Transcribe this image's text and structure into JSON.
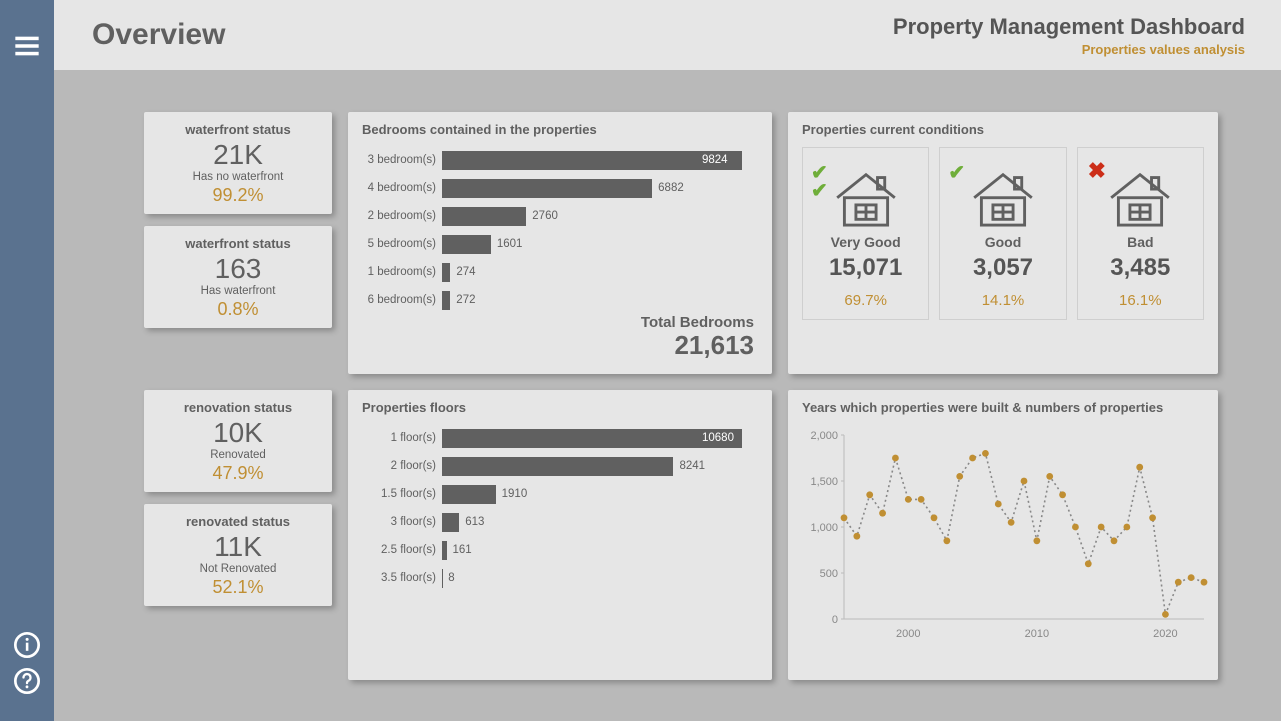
{
  "header": {
    "page_title": "Overview",
    "dash_title": "Property Management Dashboard",
    "dash_sub": "Properties values analysis"
  },
  "stats": [
    {
      "title": "waterfront status",
      "big": "21K",
      "mid": "Has no waterfront",
      "pct": "99.2%"
    },
    {
      "title": "waterfront status",
      "big": "163",
      "mid": "Has waterfront",
      "pct": "0.8%"
    },
    {
      "title": "renovation status",
      "big": "10K",
      "mid": "Renovated",
      "pct": "47.9%"
    },
    {
      "title": "renovated status",
      "big": "11K",
      "mid": "Not Renovated",
      "pct": "52.1%"
    }
  ],
  "bedrooms_card_title": "Bedrooms contained in the properties",
  "bedrooms_total_label": "Total Bedrooms",
  "bedrooms_total": "21,613",
  "floors_card_title": "Properties floors",
  "conditions_card_title": "Properties current conditions",
  "conditions": [
    {
      "label": "Very Good",
      "value": "15,071",
      "pct": "69.7%",
      "mark": "doublecheck"
    },
    {
      "label": "Good",
      "value": "3,057",
      "pct": "14.1%",
      "mark": "check"
    },
    {
      "label": "Bad",
      "value": "3,485",
      "pct": "16.1%",
      "mark": "x"
    }
  ],
  "years_card_title": "Years which properties were built & numbers of properties",
  "chart_data": [
    {
      "type": "bar",
      "title": "Bedrooms contained in the properties",
      "orientation": "horizontal",
      "categories": [
        "3 bedroom(s)",
        "4 bedroom(s)",
        "2 bedroom(s)",
        "5 bedroom(s)",
        "1 bedroom(s)",
        "6 bedroom(s)"
      ],
      "values": [
        9824,
        6882,
        2760,
        1601,
        274,
        272
      ],
      "max_axis": 9824,
      "inside_threshold": 9000,
      "total_label": "Total Bedrooms",
      "total_value": "21,613"
    },
    {
      "type": "bar",
      "title": "Properties floors",
      "orientation": "horizontal",
      "categories": [
        "1 floor(s)",
        "2 floor(s)",
        "1.5 floor(s)",
        "3 floor(s)",
        "2.5 floor(s)",
        "3.5 floor(s)"
      ],
      "values": [
        10680,
        8241,
        1910,
        613,
        161,
        8
      ],
      "max_axis": 10680,
      "inside_threshold": 10000
    },
    {
      "type": "line",
      "title": "Years which properties were built & numbers of properties",
      "xlabel": "",
      "ylabel": "",
      "y_ticks": [
        0,
        500,
        1000,
        1500,
        2000
      ],
      "x_ticks": [
        2000,
        2010,
        2020
      ],
      "x": [
        1995,
        1996,
        1997,
        1998,
        1999,
        2000,
        2001,
        2002,
        2003,
        2004,
        2005,
        2006,
        2007,
        2008,
        2009,
        2010,
        2011,
        2012,
        2013,
        2014,
        2015,
        2016,
        2017,
        2018,
        2019,
        2020,
        2021,
        2022,
        2023
      ],
      "y": [
        1100,
        900,
        1350,
        1150,
        1750,
        1300,
        1300,
        1100,
        850,
        1550,
        1750,
        1800,
        1250,
        1050,
        1500,
        850,
        1550,
        1350,
        1000,
        600,
        1000,
        850,
        1000,
        1650,
        1100,
        50,
        400,
        450,
        400
      ],
      "ylim": [
        0,
        2000
      ],
      "xlim": [
        1995,
        2023
      ]
    }
  ]
}
